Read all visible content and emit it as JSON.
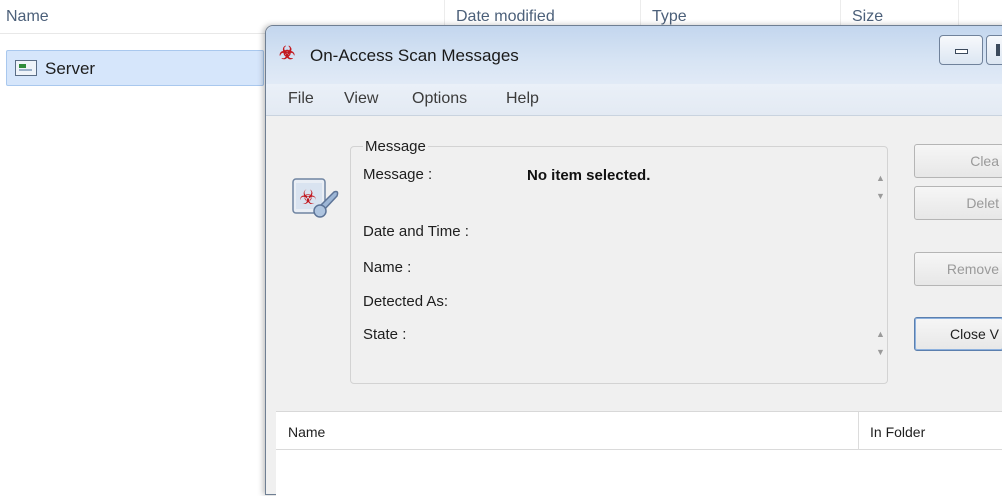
{
  "explorer": {
    "columns": [
      "Name",
      "Date modified",
      "Type",
      "Size"
    ],
    "rows": [
      {
        "name": "Server"
      }
    ]
  },
  "window": {
    "title": "On-Access Scan Messages",
    "menu": [
      "File",
      "View",
      "Options",
      "Help"
    ],
    "message_group_label": "Message",
    "fields": {
      "message_label": "Message :",
      "message_value": "No item selected.",
      "date_label": "Date and Time :",
      "name_label": "Name :",
      "detected_label": "Detected As:",
      "state_label": "State :"
    },
    "buttons": {
      "clean": "Clea",
      "delete": "Delet",
      "remove": "Remove",
      "close": "Close V"
    },
    "list_columns": [
      "Name",
      "In Folder"
    ]
  },
  "colors": {
    "titlebar": "#d7e4f4",
    "selection": "#d6e6fb",
    "accent_red": "#c2181f"
  }
}
